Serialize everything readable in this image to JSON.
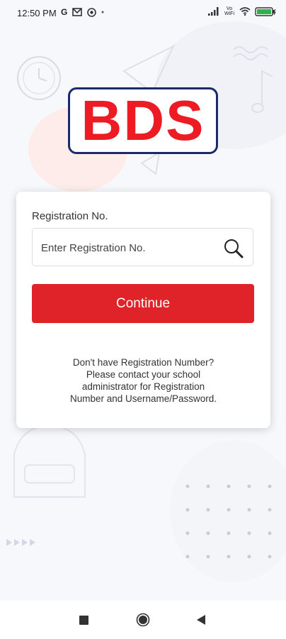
{
  "status_bar": {
    "time": "12:50 PM",
    "icons": [
      "google-icon",
      "gmail-icon",
      "app-icon",
      "dot-icon",
      "signal-icon",
      "vowifi-icon",
      "wifi-icon",
      "battery-icon"
    ],
    "vowifi": "Vo WiFi"
  },
  "logo": {
    "text": "BDS",
    "text_color": "#ed1c24",
    "border_color": "#1a2a6c"
  },
  "form": {
    "reg_label": "Registration No.",
    "reg_placeholder": "Enter Registration No.",
    "reg_value": "",
    "continue_label": "Continue",
    "button_color": "#e02328"
  },
  "help": {
    "line1": "Don't have Registration Number?",
    "line2": "Please contact your school",
    "line3": "administrator for Registration",
    "line4": "Number and Username/Password."
  },
  "nav": {
    "icons": [
      "recents-icon",
      "home-icon",
      "back-icon"
    ]
  }
}
